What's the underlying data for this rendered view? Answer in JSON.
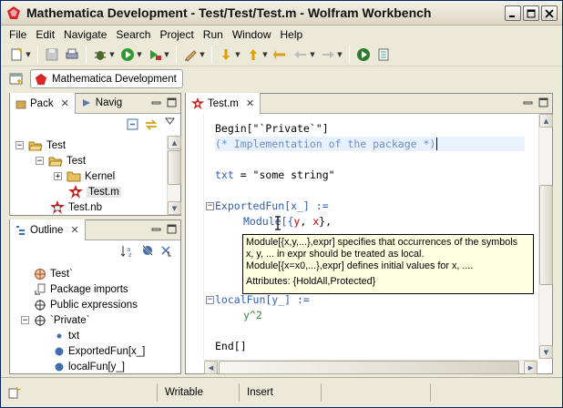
{
  "window": {
    "title": "Mathematica Development - Test/Test/Test.m - Wolfram Workbench"
  },
  "menu": [
    "File",
    "Edit",
    "Navigate",
    "Search",
    "Project",
    "Run",
    "Window",
    "Help"
  ],
  "perspective": {
    "label": "Mathematica Development"
  },
  "package_explorer": {
    "tabs": [
      "Pack",
      "Navig"
    ],
    "tree": [
      {
        "label": "Test",
        "icon": "folder-open-icon",
        "level": 0,
        "expander": "−"
      },
      {
        "label": "Test",
        "icon": "folder-open-icon",
        "level": 1,
        "expander": "−"
      },
      {
        "label": "Kernel",
        "icon": "folder-icon",
        "level": 2,
        "expander": "+"
      },
      {
        "label": "Test.m",
        "icon": "mathematica-file-icon",
        "level": 3,
        "expander": ""
      },
      {
        "label": "Test.nb",
        "icon": "notebook-icon",
        "level": 1,
        "expander": ""
      }
    ]
  },
  "outline": {
    "tab": "Outline",
    "sort_icon": "sort-az-icon",
    "items": [
      {
        "label": "Test`",
        "icon": "package-icon"
      },
      {
        "label": "Package imports",
        "icon": "imports-icon"
      },
      {
        "label": "Public expressions",
        "icon": "crosshair-icon"
      },
      {
        "label": "`Private`",
        "icon": "crosshair-icon",
        "expander": "−"
      },
      {
        "label": "txt",
        "icon": "small-dot-icon"
      },
      {
        "label": "ExportedFun[x_]",
        "icon": "blue-dot-icon"
      },
      {
        "label": "localFun[y_]",
        "icon": "blue-dot-icon"
      }
    ]
  },
  "editor": {
    "tab": "Test.m",
    "lines": {
      "l1": "Begin[\"`Private`\"]",
      "l2": "(* Implementation of the package *)",
      "l3a": "txt",
      "l3b": " = \"some string\"",
      "l4": "ExportedFun[x_] :=",
      "l5a": "Modu",
      "l5b": "le[{",
      "l5c": "y",
      "l5d": ", ",
      "l5e": "x",
      "l5f": "},",
      "l6": "localFun[y_] :=",
      "l7": "y^2",
      "l8": "End[]"
    },
    "tooltip": [
      "Module[{x,y,...},expr] specifies that occurrences of the symbols",
      "x, y, ... in expr should be treated as local.",
      "Module[{x=x0,...},expr] defines initial values for x, ....",
      "",
      "Attributes: {HoldAll,Protected}"
    ]
  },
  "status": {
    "mode": "Writable",
    "insert": "Insert"
  }
}
